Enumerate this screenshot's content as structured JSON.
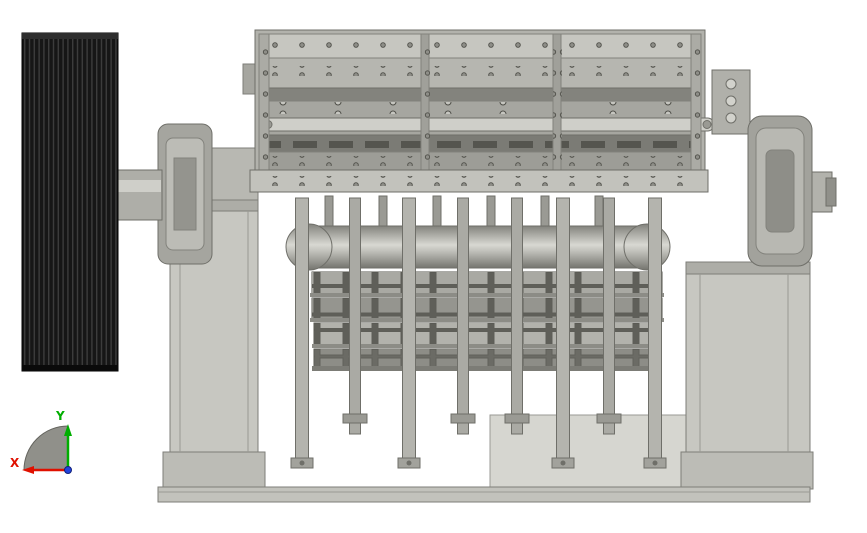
{
  "scene": {
    "background": "#ffffff"
  },
  "axis_triad": {
    "x_label": "X",
    "y_label": "Y",
    "x_color": "#e01000",
    "y_color": "#00ae00",
    "z_color": "#2244dd",
    "fan_color": "#90908a"
  },
  "palette": {
    "machine_light": "#c7c7c1",
    "machine_mid": "#a6a6a0",
    "machine_dark": "#7b7b75",
    "grate_slot": "#5f5f59",
    "pulley_black": "#161616",
    "outline": "#6f6f69"
  }
}
